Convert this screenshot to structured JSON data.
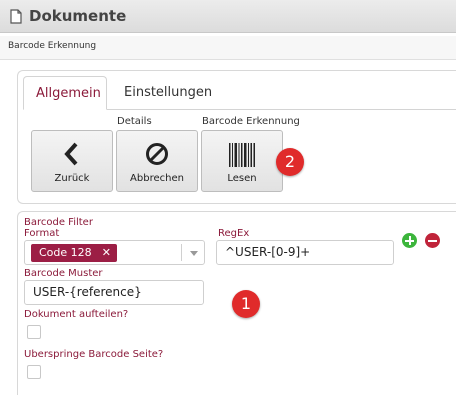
{
  "window": {
    "title": "Dokumente",
    "title_icon": "document-icon"
  },
  "panel": {
    "header": "Barcode Erkennung"
  },
  "tabs": [
    {
      "label": "Allgemein",
      "active": true
    },
    {
      "label": "Einstellungen",
      "active": false
    }
  ],
  "toolbar": {
    "details_group_label": "Details",
    "barcode_group_label": "Barcode Erkennung",
    "buttons": [
      {
        "label": "Zurück",
        "icon": "chevron-left-icon"
      },
      {
        "label": "Abbrechen",
        "icon": "cancel-icon"
      },
      {
        "label": "Lesen",
        "icon": "barcode-icon"
      }
    ]
  },
  "badges": [
    "2",
    "1"
  ],
  "form": {
    "barcode_filter_label": "Barcode Filter",
    "format_label": "Format",
    "format_selected": "Code 128",
    "chip_remove": "✕",
    "regex_label": "RegEx",
    "regex_value": "^USER-[0-9]+",
    "muster_label": "Barcode Muster",
    "muster_value": "USER-{reference}",
    "split_label": "Dokument aufteilen?",
    "skip_label": "Uberspringe Barcode Seite?"
  },
  "colors": {
    "accent": "#8b1a3a",
    "chip": "#9c1e45",
    "badge": "#e02b2b",
    "add": "#3cb53c",
    "remove": "#c0243a"
  }
}
